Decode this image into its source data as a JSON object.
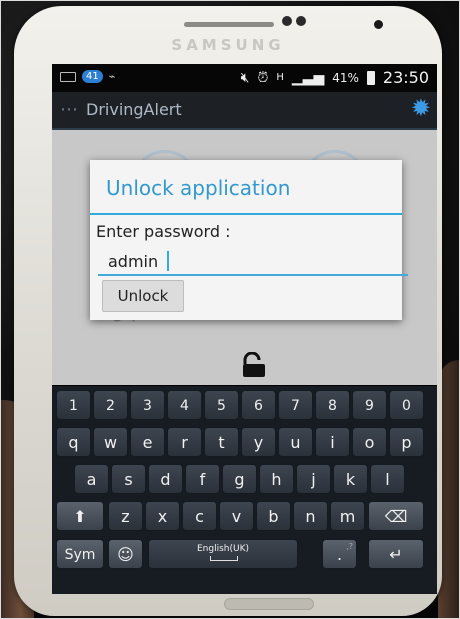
{
  "phone": {
    "brand": "SAMSUNG"
  },
  "status_bar": {
    "badge": "41",
    "battery": "41%",
    "time": "23:50",
    "network": "H",
    "icons": [
      "keyboard-icon",
      "usb-icon",
      "mute-icon",
      "alarm-icon",
      "signal-icon",
      "battery-icon"
    ]
  },
  "action_bar": {
    "title": "DrivingAlert",
    "icons": [
      "back-icon",
      "gear-icon"
    ],
    "gear_color": "#3d9ae6"
  },
  "dialog": {
    "title": "Unlock application",
    "label": "Enter password :",
    "input_value": "admin",
    "button_label": "Unlock",
    "accent": "#3399cc"
  },
  "background": {
    "text": "g      p",
    "icons": [
      "unlock-icon"
    ]
  },
  "keyboard": {
    "number_row": [
      "1",
      "2",
      "3",
      "4",
      "5",
      "6",
      "7",
      "8",
      "9",
      "0"
    ],
    "row1": [
      "q",
      "w",
      "e",
      "r",
      "t",
      "y",
      "u",
      "i",
      "o",
      "p"
    ],
    "row2": [
      "a",
      "s",
      "d",
      "f",
      "g",
      "h",
      "j",
      "k",
      "l"
    ],
    "row3": [
      "z",
      "x",
      "c",
      "v",
      "b",
      "n",
      "m"
    ],
    "sym_label": "Sym",
    "space_label": "English(UK)",
    "period_label": ".",
    "period_hint": ",?"
  }
}
